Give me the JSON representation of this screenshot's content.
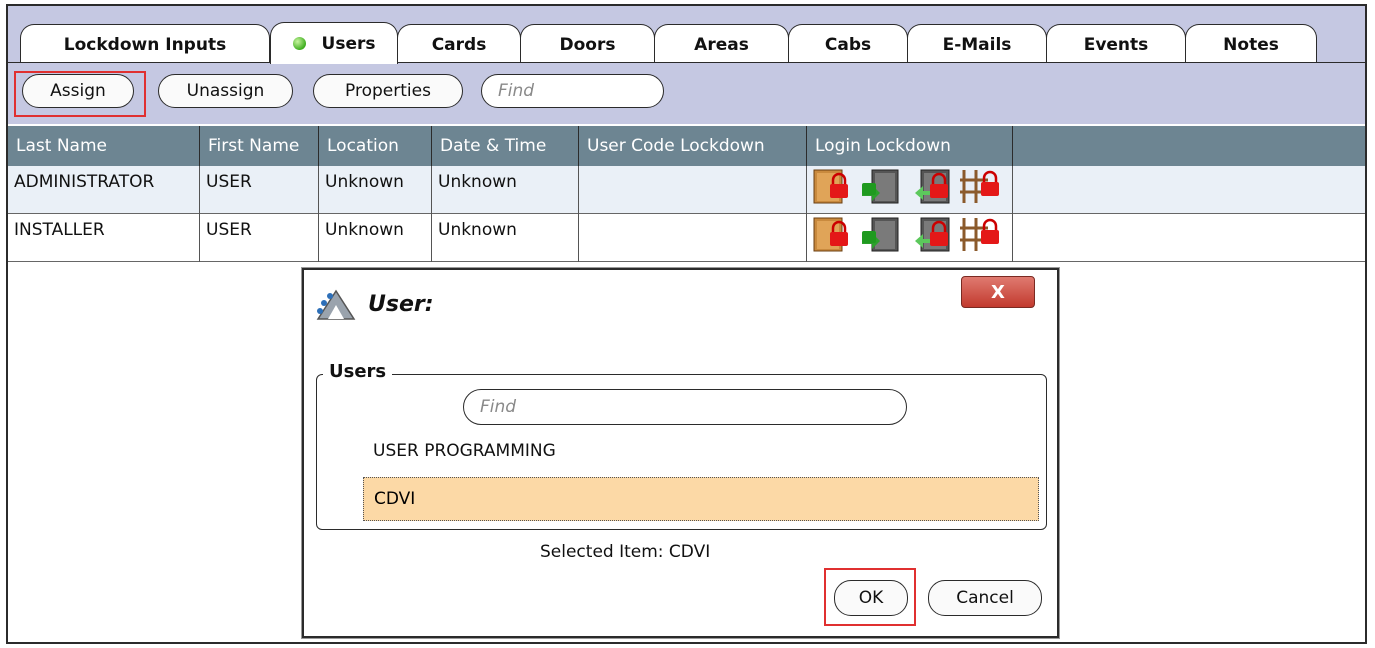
{
  "tabs": [
    {
      "label": "Lockdown Inputs"
    },
    {
      "label": "Users"
    },
    {
      "label": "Cards"
    },
    {
      "label": "Doors"
    },
    {
      "label": "Areas"
    },
    {
      "label": "Cabs"
    },
    {
      "label": "E-Mails"
    },
    {
      "label": "Events"
    },
    {
      "label": "Notes"
    }
  ],
  "toolbar": {
    "assign_label": "Assign",
    "unassign_label": "Unassign",
    "properties_label": "Properties",
    "find_placeholder": "Find"
  },
  "table": {
    "columns": [
      "Last Name",
      "First Name",
      "Location",
      "Date & Time",
      "User Code Lockdown",
      "Login Lockdown"
    ],
    "rows": [
      {
        "last_name": "ADMINISTRATOR",
        "first_name": "USER",
        "location": "Unknown",
        "date_time": "Unknown",
        "user_code_lockdown": ""
      },
      {
        "last_name": "INSTALLER",
        "first_name": "USER",
        "location": "Unknown",
        "date_time": "Unknown",
        "user_code_lockdown": ""
      }
    ],
    "login_lockdown_icons": [
      "door-lock-icon",
      "door-exit-lock-icon",
      "door-entry-lock-icon",
      "gate-lock-icon"
    ]
  },
  "dialog": {
    "title": "User:",
    "close_label": "X",
    "group_label": "Users",
    "find_placeholder": "Find",
    "items": [
      "USER PROGRAMMING",
      "CDVI"
    ],
    "selected_text": "Selected Item: CDVI",
    "ok_label": "OK",
    "cancel_label": "Cancel"
  },
  "colors": {
    "toolbar_bg": "#c5c8e2",
    "header_bg": "#6d8592",
    "selection_bg": "#fcd9a6",
    "highlight_border": "#e03030",
    "status_led": "#3fae1f"
  }
}
